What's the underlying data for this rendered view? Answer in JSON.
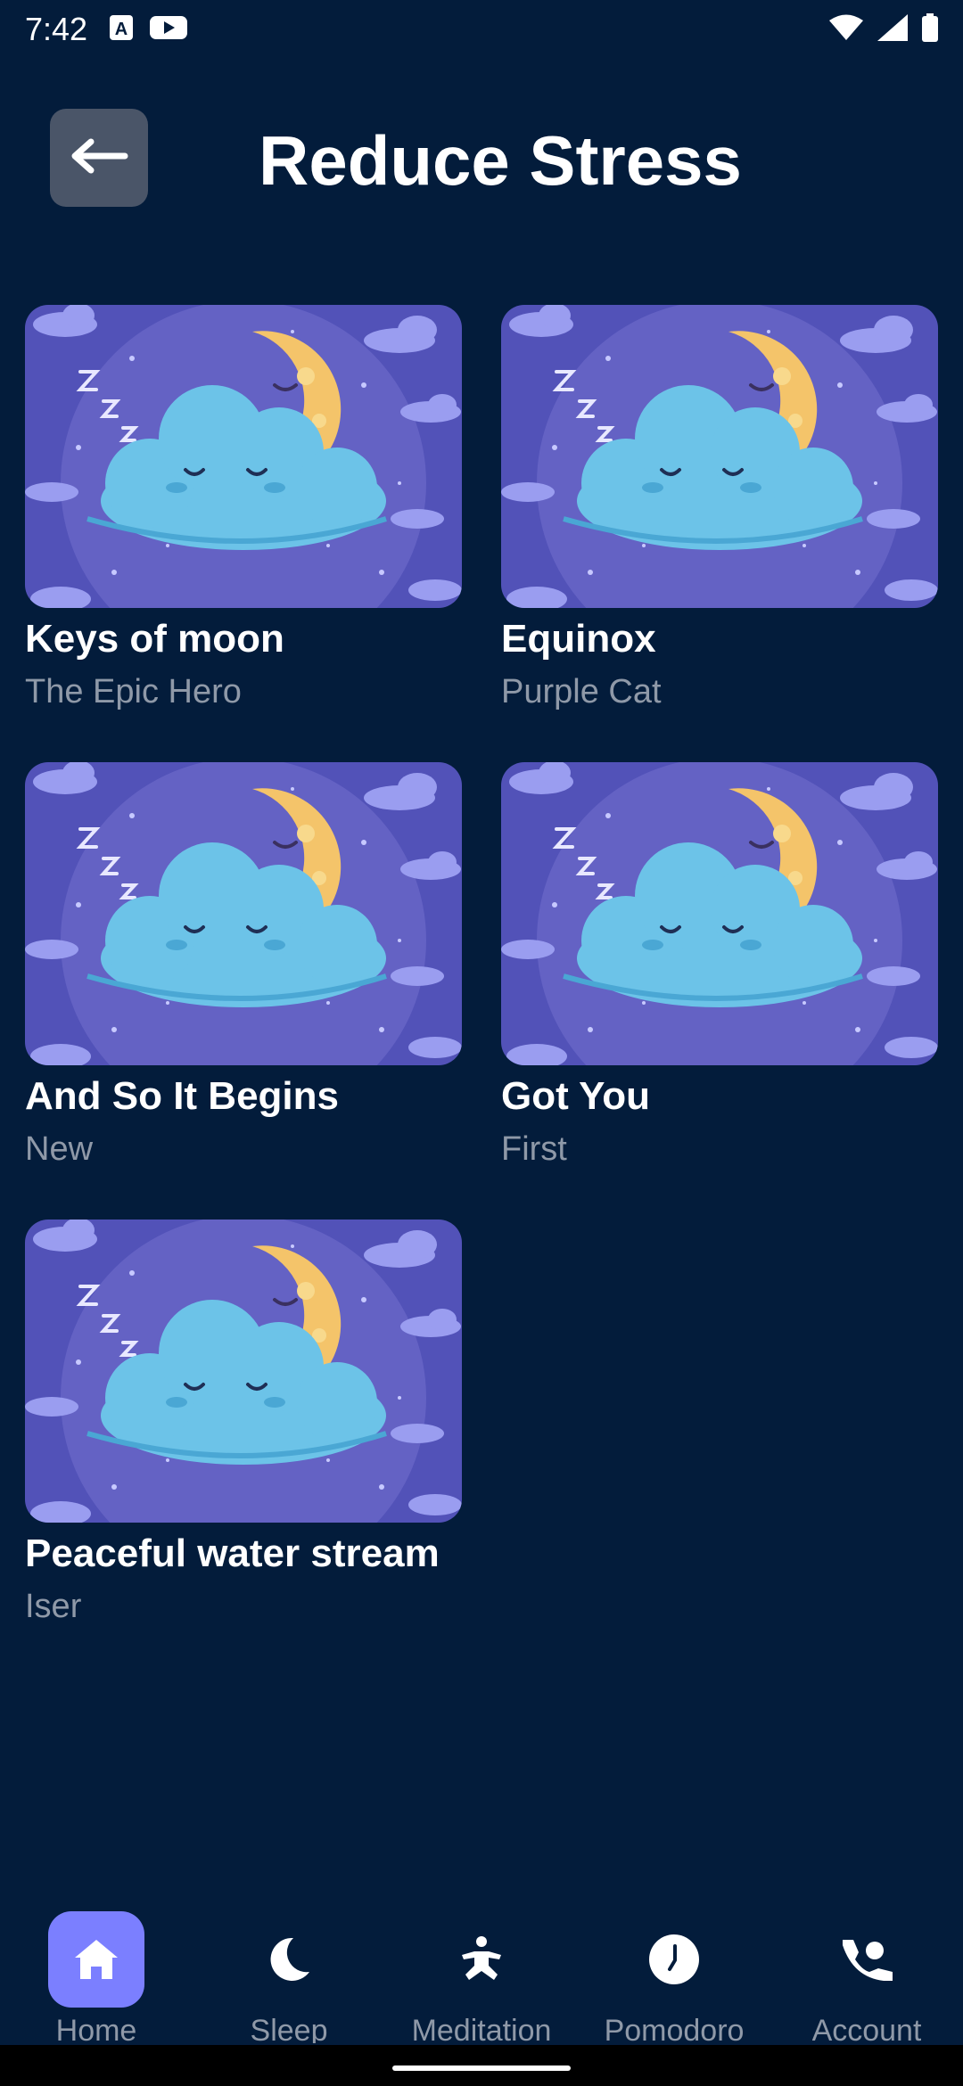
{
  "status_bar": {
    "time": "7:42",
    "icons_left": [
      "keyboard-a-icon",
      "youtube-icon"
    ],
    "icons_right": [
      "wifi-icon",
      "cell-signal-icon",
      "battery-icon"
    ]
  },
  "header": {
    "back_icon": "arrow-left-icon",
    "title": "Reduce Stress"
  },
  "tracks": [
    {
      "title": "Keys of moon",
      "artist": "The Epic Hero"
    },
    {
      "title": "Equinox",
      "artist": "Purple Cat"
    },
    {
      "title": "And So It Begins",
      "artist": "New"
    },
    {
      "title": "Got You",
      "artist": "First"
    },
    {
      "title": "Peaceful water stream",
      "artist": "Iser"
    }
  ],
  "artwork": {
    "description_icon": "sleeping-cloud-moon-artwork",
    "colors": {
      "bg": "#5252b8",
      "circle": "#6462c4",
      "cloud": "#6cc3e8",
      "moon": "#f4c46a"
    }
  },
  "nav": {
    "items": [
      {
        "label": "Home",
        "icon": "home-icon",
        "active": true
      },
      {
        "label": "Sleep",
        "icon": "moon-icon",
        "active": false
      },
      {
        "label": "Meditation",
        "icon": "meditation-icon",
        "active": false
      },
      {
        "label": "Pomodoro",
        "icon": "clock-icon",
        "active": false
      },
      {
        "label": "Account",
        "icon": "account-icon",
        "active": false
      }
    ]
  },
  "colors": {
    "background": "#031c3b",
    "accent": "#7b7fff",
    "muted_text": "#8f99a8",
    "back_button": "#4a5568"
  }
}
